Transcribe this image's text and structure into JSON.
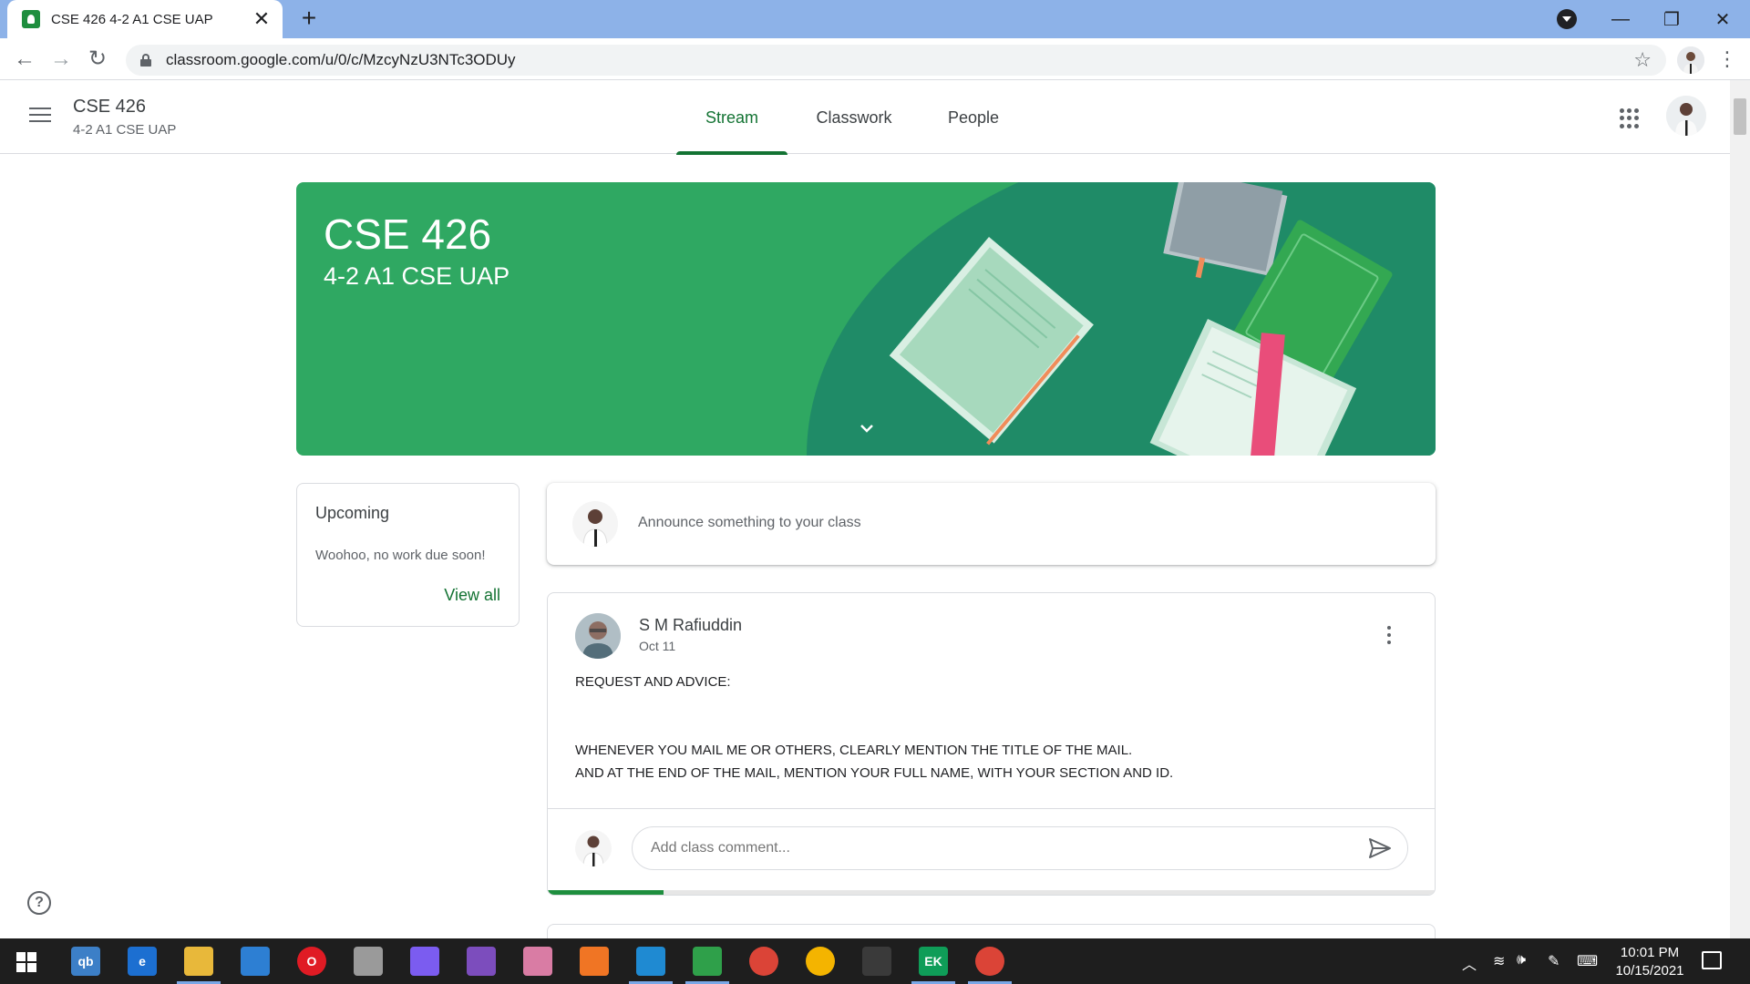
{
  "browser": {
    "tab_title": "CSE 426 4-2 A1 CSE UAP",
    "tab_close": "✕",
    "new_tab": "+",
    "url": "classroom.google.com/u/0/c/MzcyNzU3NTc3ODUy",
    "back": "←",
    "forward": "→",
    "reload": "↻",
    "star": "☆",
    "minimize": "—",
    "restore": "❐",
    "close": "✕",
    "menu": "⋮"
  },
  "header": {
    "class_name": "CSE 426",
    "section": "4-2 A1 CSE UAP",
    "tabs": [
      {
        "label": "Stream",
        "active": true
      },
      {
        "label": "Classwork",
        "active": false
      },
      {
        "label": "People",
        "active": false
      }
    ]
  },
  "banner": {
    "title": "CSE 426",
    "subtitle": "4-2 A1 CSE UAP",
    "color": "#2fa862",
    "dark_color": "#1e8c6a"
  },
  "upcoming": {
    "title": "Upcoming",
    "text": "Woohoo, no work due soon!",
    "link": "View all"
  },
  "announce": {
    "placeholder": "Announce something to your class"
  },
  "post": {
    "author": "S M Rafiuddin",
    "date": "Oct 11",
    "body": [
      "REQUEST AND ADVICE:",
      "",
      "",
      "WHENEVER YOU MAIL ME OR OTHERS, CLEARLY MENTION THE TITLE OF THE MAIL.",
      "AND AT THE END OF THE MAIL, MENTION YOUR FULL NAME, WITH YOUR SECTION AND ID."
    ],
    "comment_placeholder": "Add class comment...",
    "load_progress": 0.13
  },
  "help": "?",
  "taskbar": {
    "icons": [
      {
        "name": "qbittorrent-icon",
        "color": "#3c7fc7",
        "label": "qb"
      },
      {
        "name": "edge-icon",
        "color": "#1c6fd1",
        "label": "e"
      },
      {
        "name": "file-explorer-icon",
        "color": "#e8b83a",
        "label": ""
      },
      {
        "name": "mail-icon",
        "color": "#2d7fd3",
        "label": ""
      },
      {
        "name": "opera-icon",
        "color": "#e01b24",
        "label": "O"
      },
      {
        "name": "satellite-icon",
        "color": "#9a9a9a",
        "label": ""
      },
      {
        "name": "messenger-icon",
        "color": "#7b5cf0",
        "label": ""
      },
      {
        "name": "github-icon",
        "color": "#7c4dbd",
        "label": ""
      },
      {
        "name": "pinwheel-icon",
        "color": "#d97ca4",
        "label": ""
      },
      {
        "name": "firefox-icon",
        "color": "#f07524",
        "label": ""
      },
      {
        "name": "vscode-icon",
        "color": "#1f8ad2",
        "label": ""
      },
      {
        "name": "globe-app-icon",
        "color": "#2fa04a",
        "label": ""
      },
      {
        "name": "chrome-icon",
        "color": "#db4437",
        "label": ""
      },
      {
        "name": "chrome-icon-2",
        "color": "#f4b400",
        "label": ""
      },
      {
        "name": "terminal-icon",
        "color": "#3a3a3a",
        "label": ""
      },
      {
        "name": "chrome-profile-icon",
        "color": "#0f9d58",
        "label": "EK"
      },
      {
        "name": "chrome-active-icon",
        "color": "#db4437",
        "label": ""
      }
    ],
    "time": "10:01 PM",
    "date": "10/15/2021"
  }
}
